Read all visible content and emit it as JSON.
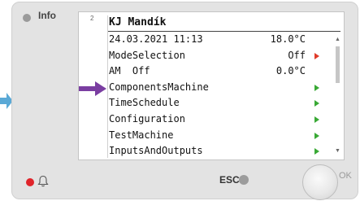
{
  "panel": {
    "info_label": "Info",
    "esc_label": "ESC",
    "ok_label": "OK"
  },
  "screen": {
    "page_number": "2",
    "title": "KJ Mandík",
    "rows": [
      {
        "label": "24.03.2021 11:13",
        "value": "18.0°C",
        "arrow": ""
      },
      {
        "label": "ModeSelection",
        "value": "Off",
        "arrow": "red"
      },
      {
        "label": "AM  Off",
        "value": "0.0°C",
        "arrow": ""
      },
      {
        "label": "ComponentsMachine",
        "value": "",
        "arrow": "green"
      },
      {
        "label": "TimeSchedule",
        "value": "",
        "arrow": "green"
      },
      {
        "label": "Configuration",
        "value": "",
        "arrow": "green"
      },
      {
        "label": "TestMachine",
        "value": "",
        "arrow": "green"
      },
      {
        "label": "InputsAndOutputs",
        "value": "",
        "arrow": "green"
      }
    ],
    "selected_row_index": 3
  },
  "icons": {
    "side_arrow": "arrow-right-icon",
    "selection_arrow": "arrow-right-icon",
    "bell": "bell-icon",
    "scroll_up": "chevron-up-icon",
    "scroll_down": "chevron-down-icon"
  },
  "colors": {
    "panel_bg": "#e3e3e3",
    "side_arrow": "#5aa9d6",
    "selection_arrow": "#7a3ea1",
    "nav_arrow_green": "#39a935",
    "nav_arrow_red": "#e03b2a",
    "alarm_led": "#e0242a"
  }
}
